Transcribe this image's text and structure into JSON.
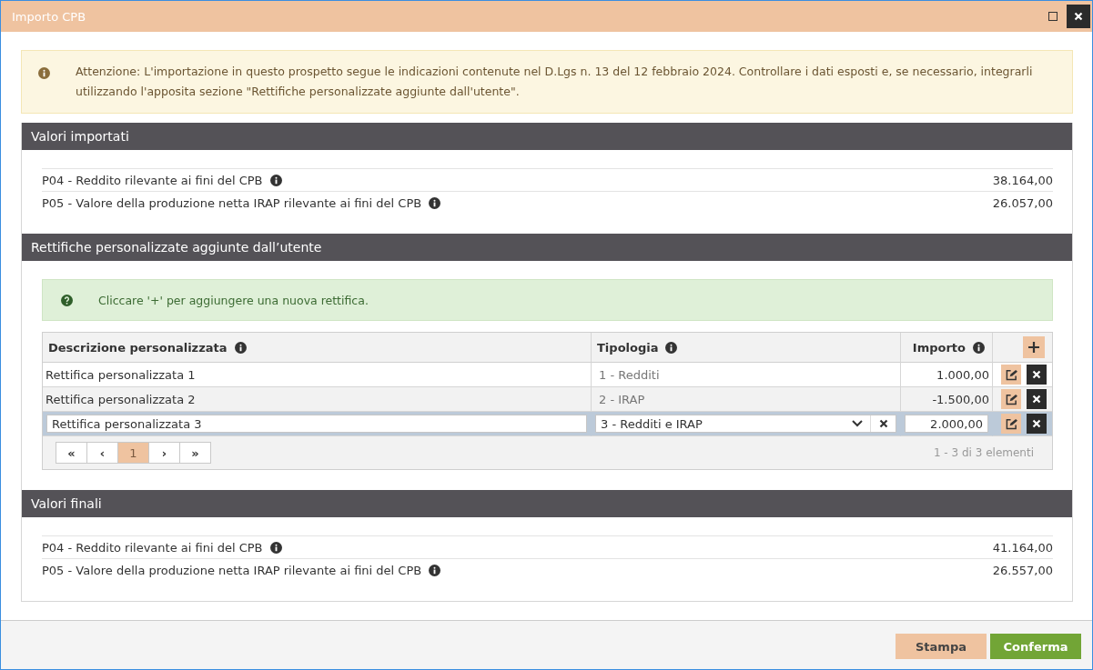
{
  "window": {
    "title": "Importo CPB"
  },
  "warning": "Attenzione: L'importazione in questo prospetto segue le indicazioni contenute nel D.Lgs n. 13 del 12 febbraio 2024. Controllare i dati esposti e, se necessario, integrarli utilizzando l'apposita sezione \"Rettifiche personalizzate aggiunte dall'utente\".",
  "imported": {
    "title": "Valori importati",
    "rows": [
      {
        "label": "P04 - Reddito rilevante ai fini del CPB",
        "value": "38.164,00"
      },
      {
        "label": "P05 - Valore della produzione netta IRAP rilevante ai fini del CPB",
        "value": "26.057,00"
      }
    ]
  },
  "adjustments": {
    "title": "Rettifiche personalizzate aggiunte dall’utente",
    "hint": "Cliccare '+' per aggiungere una nuova rettifica.",
    "columns": [
      "Descrizione personalizzata",
      "Tipologia",
      "Importo"
    ],
    "rows": [
      {
        "description": "Rettifica personalizzata 1",
        "type": "1 - Redditi",
        "amount": "1.000,00",
        "editing": false
      },
      {
        "description": "Rettifica personalizzata 2",
        "type": "2 - IRAP",
        "amount": "-1.500,00",
        "editing": false
      },
      {
        "description": "Rettifica personalizzata 3",
        "type": "3 - Redditi e IRAP",
        "amount": "2.000,00",
        "editing": true
      }
    ],
    "pager": {
      "first": "«",
      "prev": "‹",
      "pages": [
        {
          "label": "1",
          "selected": true
        }
      ],
      "next": "›",
      "last": "»",
      "summary": "1 - 3 di 3 elementi"
    }
  },
  "final": {
    "title": "Valori finali",
    "rows": [
      {
        "label": "P04 - Reddito rilevante ai fini del CPB",
        "value": "41.164,00"
      },
      {
        "label": "P05 - Valore della produzione netta IRAP rilevante ai fini del CPB",
        "value": "26.557,00"
      }
    ]
  },
  "buttons": [
    {
      "label": "Stampa",
      "kind": "secondary"
    },
    {
      "label": "Conferma",
      "kind": "primary"
    }
  ]
}
